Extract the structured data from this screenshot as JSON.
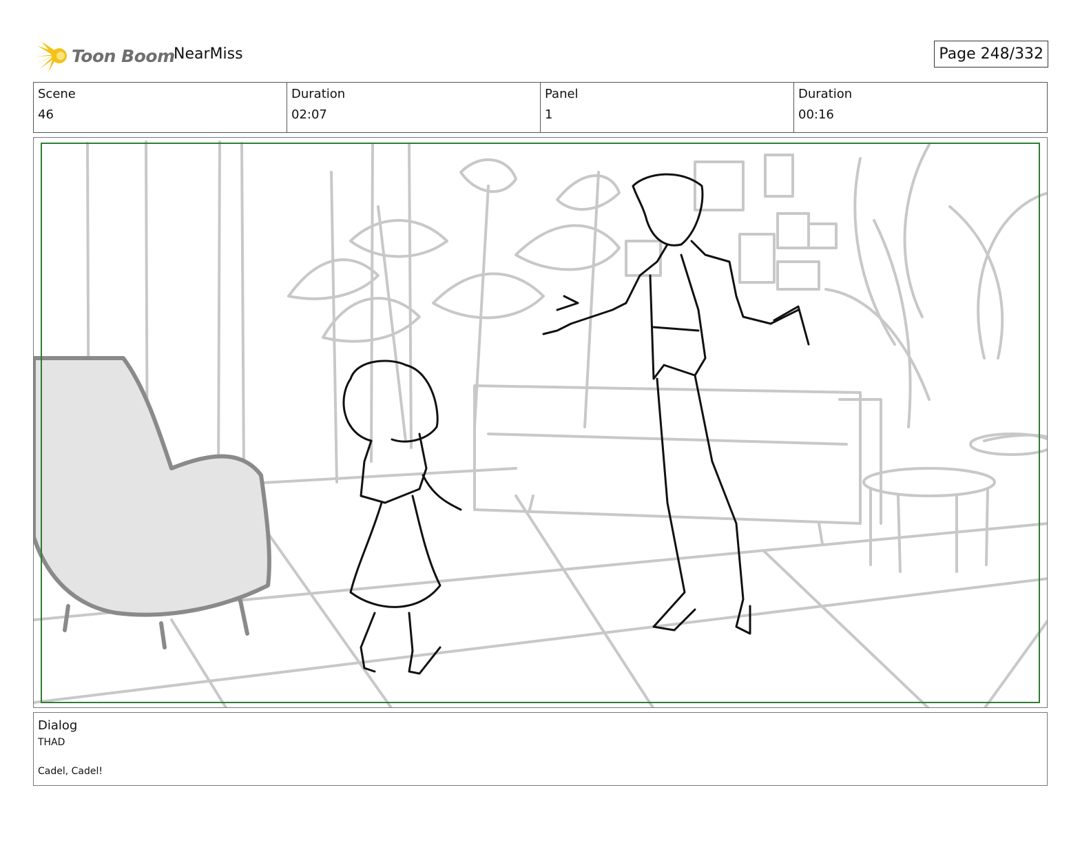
{
  "header": {
    "logo_text": "Toon Boom",
    "project_name": "NearMiss",
    "page_label": "Page 248/332"
  },
  "info": {
    "scene_label": "Scene",
    "scene_value": "46",
    "duration_label": "Duration",
    "duration_value": "02:07",
    "panel_label": "Panel",
    "panel_value": "1",
    "panel_duration_label": "Duration",
    "panel_duration_value": "00:16"
  },
  "dialog": {
    "label": "Dialog",
    "speaker": "THAD",
    "line": "Cadel, Cadel!"
  },
  "colors": {
    "safe_frame": "#2e7d32",
    "sketch_bg": "#c8c8c8",
    "sketch_fg": "#111111",
    "chair_fill": "#e4e4e4"
  }
}
